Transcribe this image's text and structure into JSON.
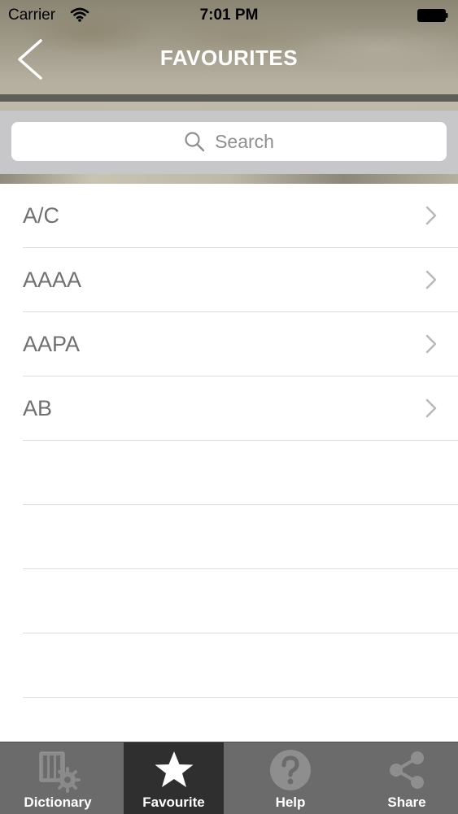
{
  "status_bar": {
    "carrier": "Carrier",
    "time": "7:01 PM"
  },
  "nav": {
    "title": "FAVOURITES",
    "back_icon": "chevron-left-icon"
  },
  "search": {
    "placeholder": "Search"
  },
  "list": {
    "items": [
      {
        "label": "A/C"
      },
      {
        "label": "AAAA"
      },
      {
        "label": "AAPA"
      },
      {
        "label": "AB"
      }
    ]
  },
  "tab_bar": {
    "tabs": [
      {
        "label": "Dictionary",
        "icon": "dictionary-gear-icon",
        "active": false
      },
      {
        "label": "Favourite",
        "icon": "star-icon",
        "active": true
      },
      {
        "label": "Help",
        "icon": "question-icon",
        "active": false
      },
      {
        "label": "Share",
        "icon": "share-icon",
        "active": false
      }
    ]
  },
  "colors": {
    "tab_bar_bg": "#6b6b6b",
    "tab_active_bg": "#2f2f2f",
    "list_text": "#707070",
    "separator": "#dcdcdc"
  }
}
